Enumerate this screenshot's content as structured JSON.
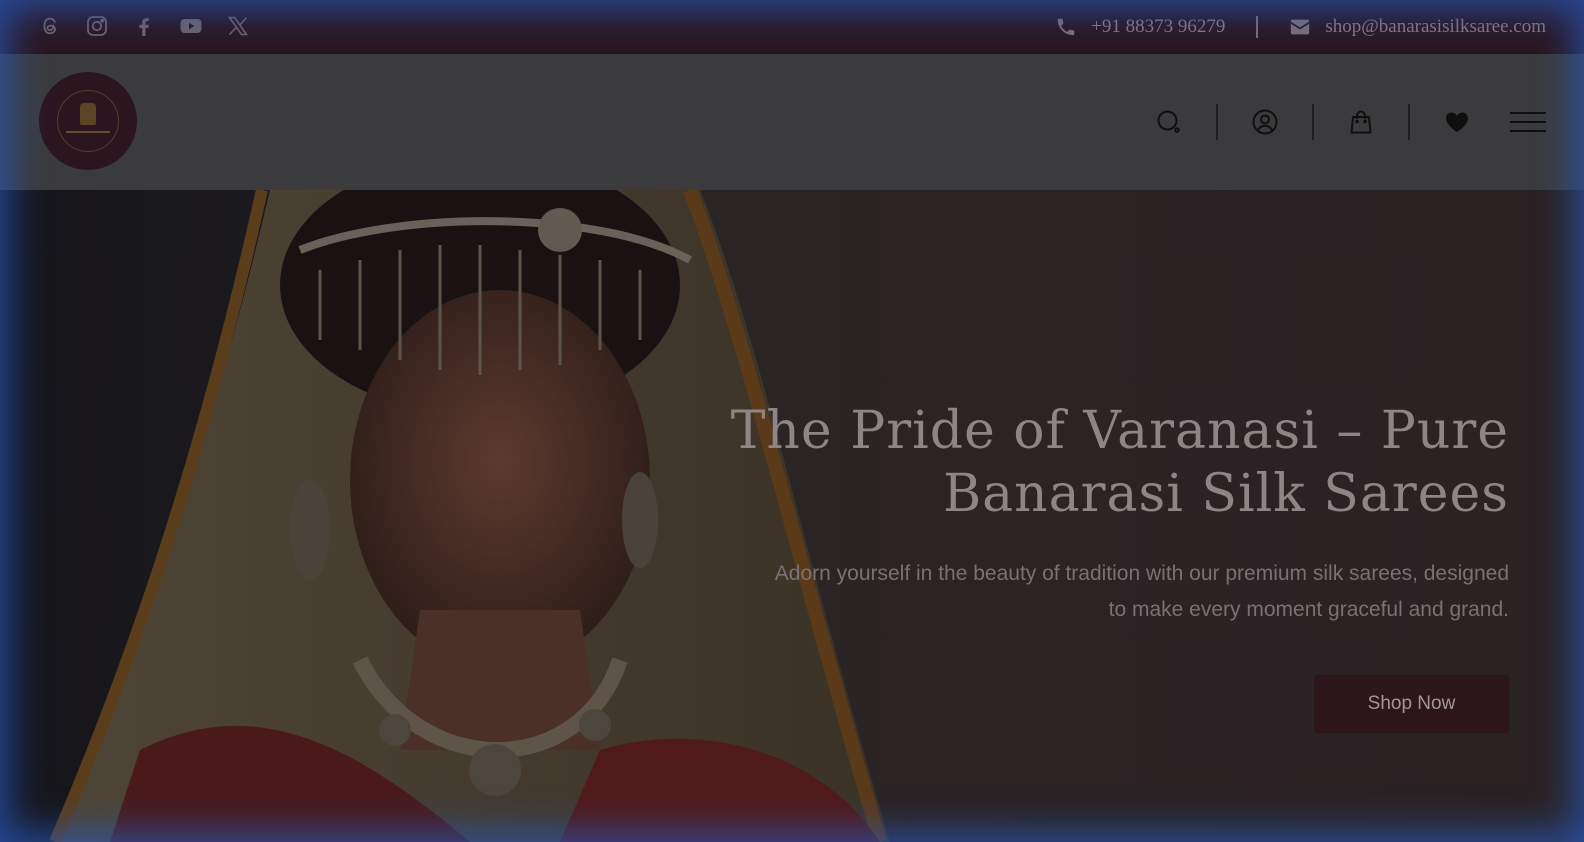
{
  "topbar": {
    "social": [
      {
        "name": "threads-icon"
      },
      {
        "name": "instagram-icon"
      },
      {
        "name": "facebook-icon"
      },
      {
        "name": "youtube-icon"
      },
      {
        "name": "x-icon"
      }
    ],
    "phone": "+91 88373 96279",
    "email": "shop@banarasisilksaree.com"
  },
  "header": {
    "logo_icon": "brand-logo",
    "icons": [
      "search-icon",
      "account-icon",
      "shopping-bag-icon",
      "heart-icon",
      "hamburger-menu-icon"
    ]
  },
  "hero": {
    "title_line1": "The Pride of Varanasi – Pure",
    "title_line2": "Banarasi Silk Sarees",
    "subtitle_line1": "Adorn yourself in the beauty of tradition with our premium silk sarees, designed",
    "subtitle_line2": "to make every moment graceful and grand.",
    "cta_label": "Shop Now"
  },
  "colors": {
    "topbar_bg": "#2a1620",
    "header_bg": "#3b3b3d",
    "brand_maroon": "#2c161c",
    "glow": "#2d5bbf"
  }
}
